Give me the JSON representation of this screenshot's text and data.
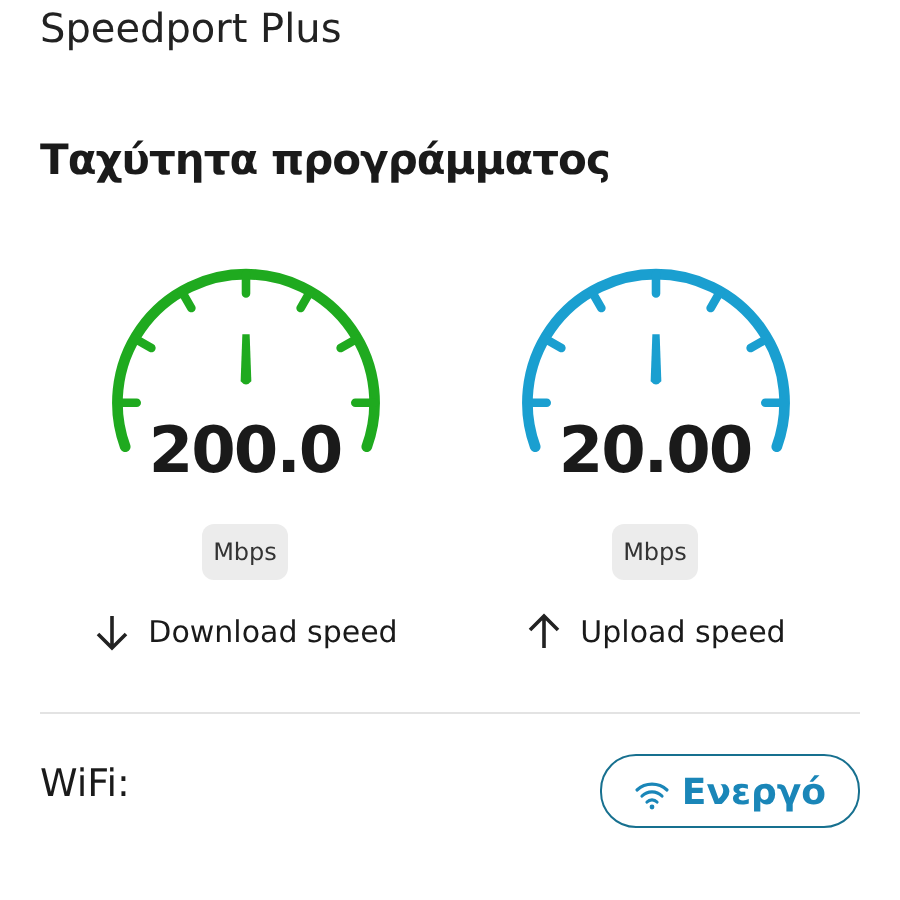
{
  "device_name": "Speedport Plus",
  "section_title": "Ταχύτητα προγράμματος",
  "gauges": [
    {
      "value": "200.0",
      "unit": "Mbps",
      "kind": "download",
      "label": "Download speed",
      "color": "#1faa1f"
    },
    {
      "value": "20.00",
      "unit": "Mbps",
      "kind": "upload",
      "label": "Upload speed",
      "color": "#1a9fd0"
    }
  ],
  "wifi": {
    "label": "WiFi:",
    "button": "Ενεργό"
  }
}
